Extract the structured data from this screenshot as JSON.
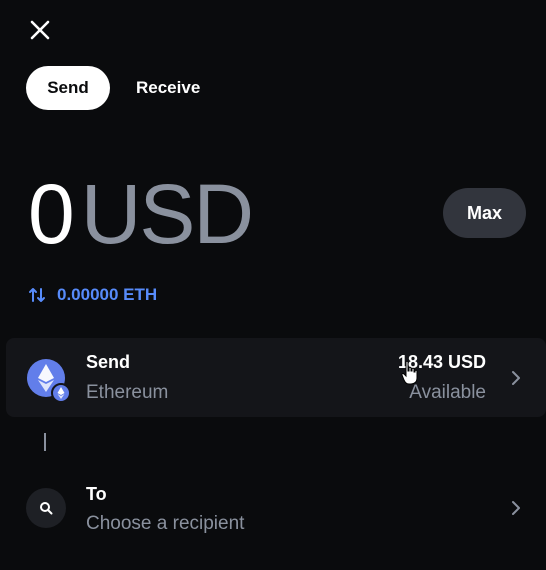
{
  "header": {
    "close_icon": "close-icon"
  },
  "tabs": [
    {
      "label": "Send",
      "active": true
    },
    {
      "label": "Receive",
      "active": false
    }
  ],
  "amount": {
    "value": "0",
    "unit": "USD"
  },
  "max_button": {
    "label": "Max"
  },
  "conversion": {
    "text": "0.00000 ETH",
    "icon": "swap-arrows-icon"
  },
  "send_card": {
    "title": "Send",
    "asset_name": "Ethereum",
    "balance": "18.43 USD",
    "balance_label": "Available",
    "asset_icon": "ethereum-icon"
  },
  "recipient": {
    "title": "To",
    "placeholder": "Choose a recipient",
    "icon": "search-icon"
  },
  "colors": {
    "background": "#0a0b0d",
    "accent": "#578bfa",
    "muted_text": "#8a919e",
    "card": "#141519",
    "button": "#32353d"
  }
}
